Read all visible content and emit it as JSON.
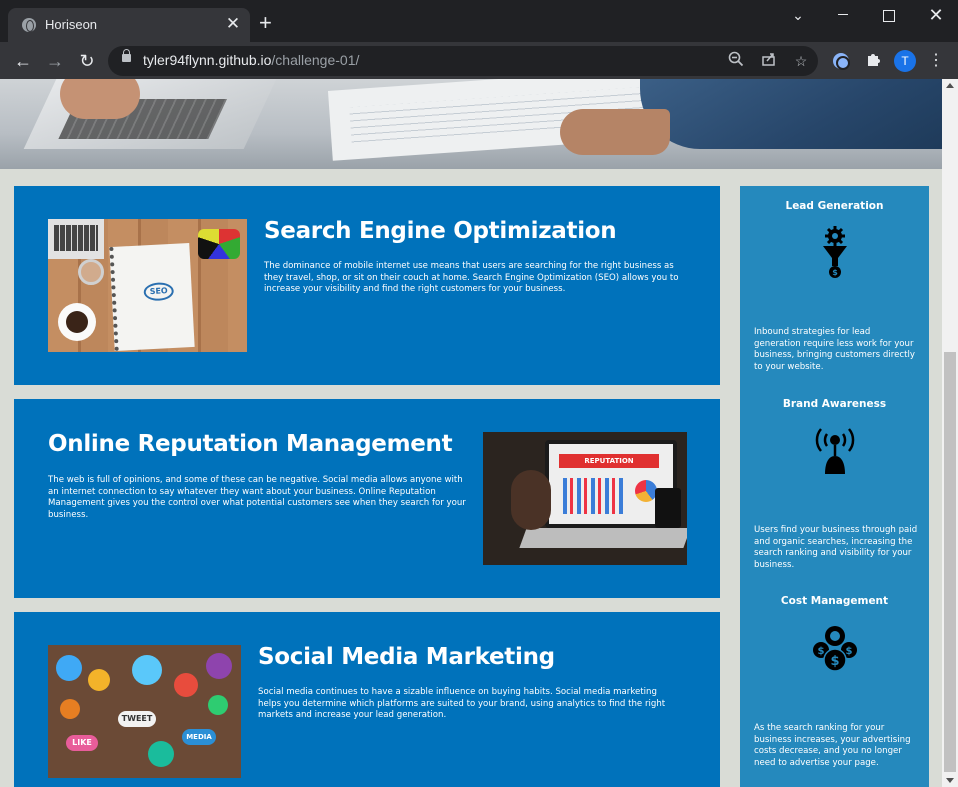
{
  "browser": {
    "tab_title": "Horiseon",
    "tab_close": "✕",
    "new_tab": "+",
    "url_domain": "tyler94flynn.github.io",
    "url_path": "/challenge-01/",
    "avatar_letter": "T"
  },
  "sections": [
    {
      "title": "Search Engine Optimization",
      "body": "The dominance of mobile internet use means that users are searching for the right business as they travel, shop, or sit on their couch at home. Search Engine Optimization (SEO) allows you to increase your visibility and find the right customers for your business.",
      "image_text": "SEO"
    },
    {
      "title": "Online Reputation Management",
      "body": "The web is full of opinions, and some of these can be negative. Social media allows anyone with an internet connection to say whatever they want about your business. Online Reputation Management gives you the control over what potential customers see when they search for your business.",
      "image_text": "REPUTATION"
    },
    {
      "title": "Social Media Marketing",
      "body": "Social media continues to have a sizable influence on buying habits. Social media marketing helps you determine which platforms are suited to your brand, using analytics to find the right markets and increase your lead generation.",
      "image_tags": [
        "TWEET",
        "LIKE",
        "MEDIA"
      ]
    }
  ],
  "benefits": [
    {
      "title": "Lead Generation",
      "icon": "funnel-gear-icon",
      "body": "Inbound strategies for lead generation require less work for your business, bringing customers directly to your website."
    },
    {
      "title": "Brand Awareness",
      "icon": "broadcast-person-icon",
      "body": "Users find your business through paid and organic searches, increasing the search ranking and visibility for your business."
    },
    {
      "title": "Cost Management",
      "icon": "dollar-gears-icon",
      "body": "As the search ranking for your business increases, your advertising costs decrease, and you no longer need to advertise your page."
    }
  ],
  "colors": {
    "card_blue": "#0072bb",
    "aside_blue": "#2589bd",
    "page_bg": "#d9dcd6"
  }
}
